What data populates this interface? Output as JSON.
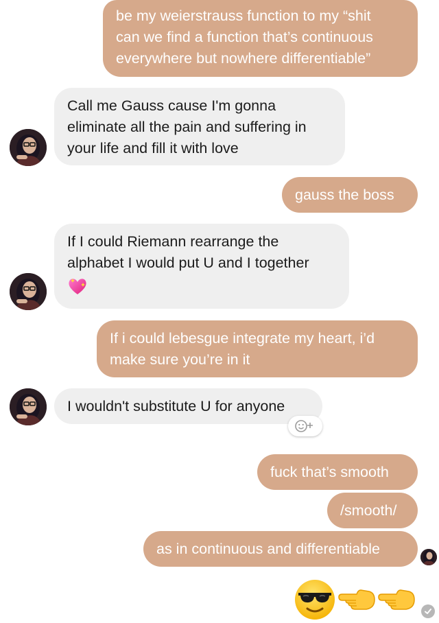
{
  "conversation": {
    "messages": [
      {
        "from": "me",
        "lines": [
          "be my weierstrauss function to my “shit",
          "can we find a function that’s continuous",
          "everywhere but nowhere differentiable”"
        ]
      },
      {
        "from": "them",
        "lines": [
          "Call me Gauss cause I'm gonna",
          "eliminate all the pain and suffering in",
          "your life and fill it with love"
        ]
      },
      {
        "from": "me",
        "lines": [
          "gauss the boss"
        ]
      },
      {
        "from": "them",
        "lines": [
          "If I could Riemann rearrange the",
          "alphabet I would put U and I together"
        ],
        "emoji": "sparkling-heart"
      },
      {
        "from": "me",
        "lines": [
          "If i could lebesgue integrate my heart, i’d",
          "make sure you’re in it"
        ]
      },
      {
        "from": "them",
        "lines": [
          "I wouldn't substitute U for anyone"
        ]
      },
      {
        "from": "me",
        "lines": [
          "fuck that’s smooth"
        ]
      },
      {
        "from": "me",
        "lines": [
          "/smooth/"
        ]
      },
      {
        "from": "me",
        "lines": [
          "as in continuous and differentiable"
        ]
      },
      {
        "from": "me",
        "emoji_only": [
          "sunglasses-face",
          "backhand-index-pointing-left",
          "backhand-index-pointing-left"
        ]
      }
    ]
  },
  "colors": {
    "outgoing_bubble": "#d6a98b",
    "incoming_bubble": "#efefef",
    "outgoing_text": "#ffffff",
    "incoming_text": "#1b1b1b"
  },
  "icons": {
    "react": "add-reaction-icon",
    "read_receipt": "read-check-icon"
  }
}
